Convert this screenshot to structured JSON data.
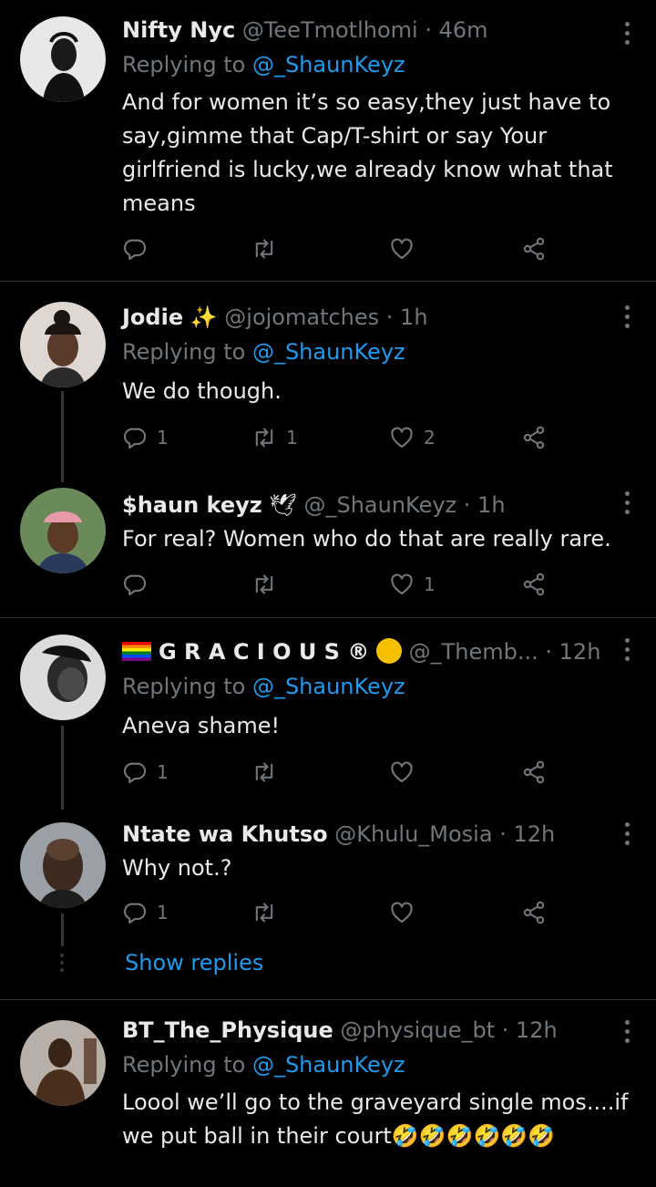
{
  "icons": {
    "reply": "reply-icon",
    "retweet": "retweet-icon",
    "like": "like-icon",
    "share": "share-icon",
    "more": "more-icon"
  },
  "colors": {
    "accent": "#1d9bf0",
    "muted": "#71767b",
    "text": "#e7e9ea",
    "background": "#000000"
  },
  "tweets": [
    {
      "name": "Nifty Nyc",
      "handle": "@TeeTmotlhomi",
      "time": "· 46m",
      "replying_prefix": "Replying to ",
      "replying_mention": "@_ShaunKeyz",
      "text": "And for women it’s so easy,they just have to say,gimme that Cap/T-shirt or say Your girlfriend is lucky,we already know what that means",
      "replies": "",
      "retweets": "",
      "likes": ""
    },
    {
      "name": "Jodie",
      "name_suffix": "✨",
      "handle": "@jojomatches",
      "time": "· 1h",
      "replying_prefix": "Replying to ",
      "replying_mention": "@_ShaunKeyz",
      "text": "We do though.",
      "replies": "1",
      "retweets": "1",
      "likes": "2"
    },
    {
      "name": "$haun keyz",
      "name_suffix": "🕊",
      "handle": "@_ShaunKeyz",
      "time": "· 1h",
      "text": "For real? Women who do that are really rare.",
      "replies": "",
      "retweets": "",
      "likes": "1"
    },
    {
      "name": "G R A C I O U S ®",
      "handle": "@_Themb...",
      "time": "· 12h",
      "replying_prefix": "Replying to ",
      "replying_mention": "@_ShaunKeyz",
      "text": "Aneva shame!",
      "replies": "1",
      "retweets": "",
      "likes": ""
    },
    {
      "name": "Ntate wa Khutso",
      "handle": "@Khulu_Mosia",
      "time": "· 12h",
      "text": "Why not.?",
      "replies": "1",
      "retweets": "",
      "likes": "",
      "show_replies": "Show replies"
    },
    {
      "name": "BT_The_Physique",
      "handle": "@physique_bt",
      "time": "· 12h",
      "replying_prefix": "Replying to ",
      "replying_mention": "@_ShaunKeyz",
      "text": "Loool we’ll go to the graveyard single mos....if we put ball in their court🤣🤣🤣🤣🤣🤣"
    }
  ]
}
